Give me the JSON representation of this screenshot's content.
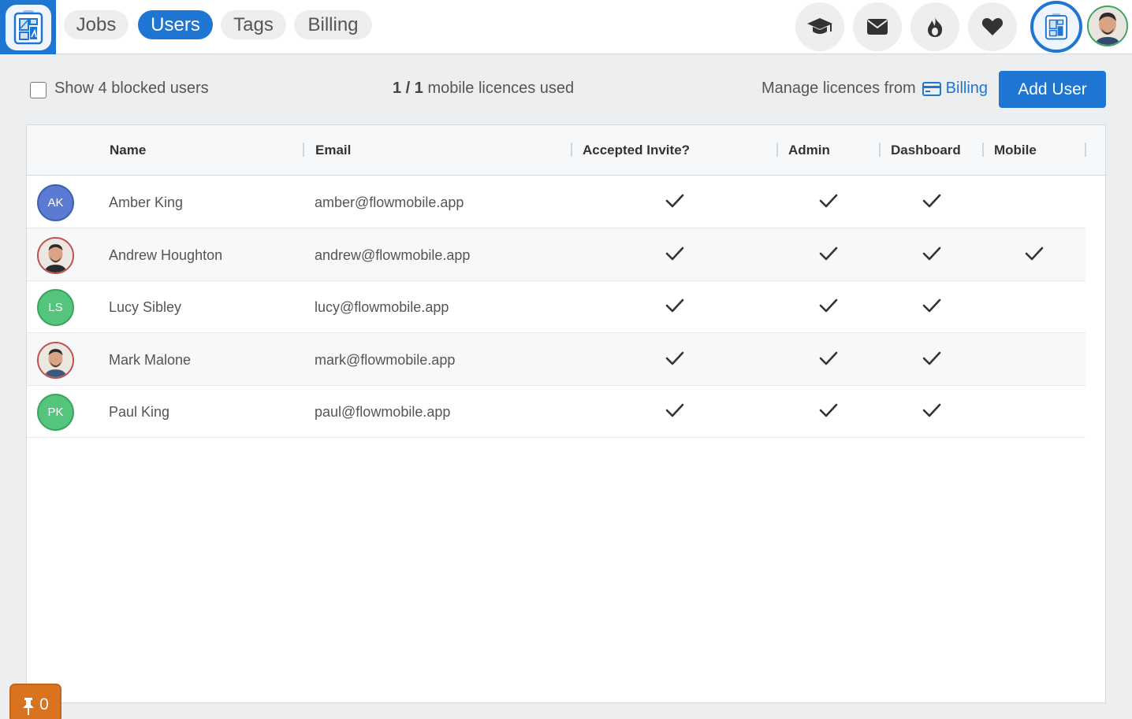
{
  "nav": {
    "tabs": [
      {
        "label": "Jobs",
        "active": false
      },
      {
        "label": "Users",
        "active": true
      },
      {
        "label": "Tags",
        "active": false
      },
      {
        "label": "Billing",
        "active": false
      }
    ],
    "icons": [
      "graduation-cap-icon",
      "envelope-icon",
      "fire-icon",
      "heart-icon"
    ],
    "accent_color": "#1f76d2"
  },
  "toolbar": {
    "blocked_label": "Show 4 blocked users",
    "licences_used": "1 / 1",
    "licences_label": "mobile licences used",
    "manage_label": "Manage licences from",
    "billing_link": "Billing",
    "add_user": "Add User"
  },
  "table": {
    "columns": [
      "Name",
      "Email",
      "Accepted Invite?",
      "Admin",
      "Dashboard",
      "Mobile"
    ],
    "rows": [
      {
        "initials": "AK",
        "avatar_color": "#5a7bd1",
        "photo": false,
        "name": "Amber King",
        "email": "amber@flowmobile.app",
        "accepted": true,
        "admin": true,
        "dashboard": true,
        "mobile": false
      },
      {
        "initials": "",
        "avatar_color": "#ffffff",
        "photo": true,
        "name": "Andrew Houghton",
        "email": "andrew@flowmobile.app",
        "accepted": true,
        "admin": true,
        "dashboard": true,
        "mobile": true
      },
      {
        "initials": "LS",
        "avatar_color": "#55c47d",
        "photo": false,
        "name": "Lucy Sibley",
        "email": "lucy@flowmobile.app",
        "accepted": true,
        "admin": true,
        "dashboard": true,
        "mobile": false
      },
      {
        "initials": "",
        "avatar_color": "#ffffff",
        "photo": true,
        "name": "Mark Malone",
        "email": "mark@flowmobile.app",
        "accepted": true,
        "admin": true,
        "dashboard": true,
        "mobile": false
      },
      {
        "initials": "PK",
        "avatar_color": "#55c47d",
        "photo": false,
        "name": "Paul King",
        "email": "paul@flowmobile.app",
        "accepted": true,
        "admin": true,
        "dashboard": true,
        "mobile": false
      }
    ]
  },
  "pin_badge": {
    "count": "0",
    "color": "#d9731f"
  }
}
